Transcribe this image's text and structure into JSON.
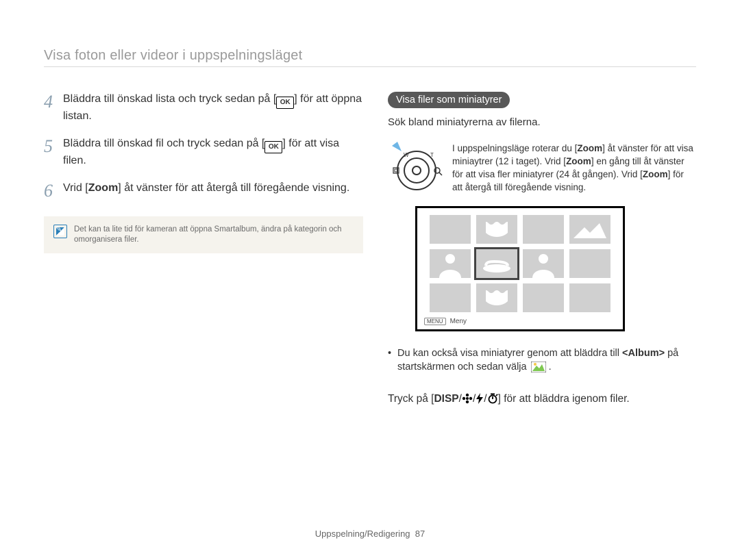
{
  "header": "Visa foton eller videor i uppspelningsläget",
  "steps": [
    {
      "num": "4",
      "pre": "Bläddra till önskad lista och tryck sedan på [",
      "mid_icon": "OK",
      "post": "] för att öppna listan."
    },
    {
      "num": "5",
      "pre": "Bläddra till önskad fil och tryck sedan på [",
      "mid_icon": "OK",
      "post": "] för att visa filen."
    },
    {
      "num": "6",
      "pre": "Vrid [",
      "bold": "Zoom",
      "post": "] åt vänster för att återgå till föregående visning."
    }
  ],
  "note": "Det kan ta lite tid för kameran att öppna Smartalbum, ändra på kategorin och omorganisera filer.",
  "right": {
    "section_title": "Visa filer som miniatyrer",
    "intro": "Sök bland miniatyrerna av filerna.",
    "zoom_text": {
      "b1": "Zoom",
      "b2": "Zoom",
      "b3": "Zoom",
      "p1": "I uppspelningsläge roterar du [",
      "p2": "] åt vänster för att visa miniaytrer (12 i taget). Vrid [",
      "p3": "] en gång till åt vänster för att visa fler miniatyrer (24 åt gången). Vrid [",
      "p4": "] för att återgå till föregående visning."
    },
    "screen_footer_label": "MENU",
    "screen_footer_text": "Meny",
    "bullet_pre": "Du kan också visa miniatyrer genom att bläddra till ",
    "bullet_bold": "<Album>",
    "bullet_post": " på startskärmen och sedan välja ",
    "disp_pre": "Tryck på [",
    "disp_label": "DISP",
    "disp_post": "] för att bläddra igenom filer."
  },
  "footer": {
    "section": "Uppspelning/Redigering",
    "page": "87"
  }
}
